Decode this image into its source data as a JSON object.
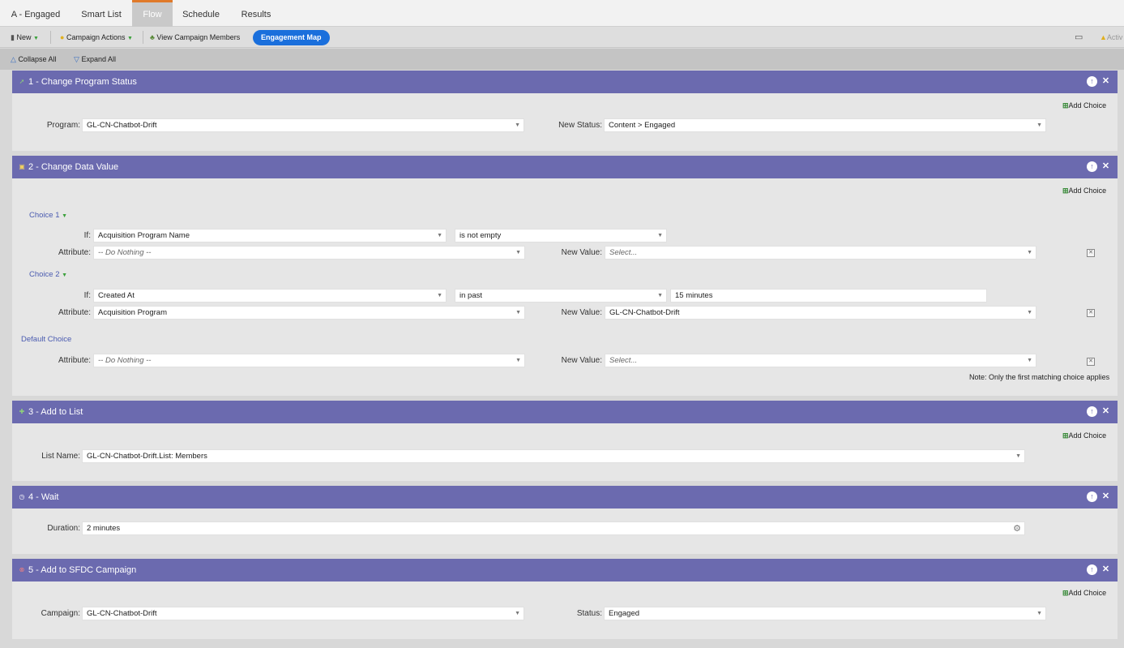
{
  "tabs": [
    "A - Engaged",
    "Smart List",
    "Flow",
    "Schedule",
    "Results"
  ],
  "active_tab": "Flow",
  "toolbar": {
    "new": "New",
    "campaign_actions": "Campaign Actions",
    "view_members": "View Campaign Members",
    "engagement_map": "Engagement Map",
    "active_label": "Activ"
  },
  "subbar": {
    "collapse": "Collapse All",
    "expand": "Expand All"
  },
  "step1": {
    "title": "1 - Change Program Status",
    "add_choice": "Add Choice",
    "program_label": "Program:",
    "program_value": "GL-CN-Chatbot-Drift",
    "status_label": "New Status:",
    "status_value": "Content > Engaged"
  },
  "step2": {
    "title": "2 - Change Data Value",
    "add_choice": "Add Choice",
    "choice1": {
      "label": "Choice 1",
      "if_label": "If:",
      "if_field": "Acquisition Program Name",
      "if_operator": "is not empty",
      "attr_label": "Attribute:",
      "attr_value": "-- Do Nothing --",
      "newval_label": "New Value:",
      "newval_value": "Select..."
    },
    "choice2": {
      "label": "Choice 2",
      "if_label": "If:",
      "if_field": "Created At",
      "if_operator": "in past",
      "if_value": "15 minutes",
      "attr_label": "Attribute:",
      "attr_value": "Acquisition Program",
      "newval_label": "New Value:",
      "newval_value": "GL-CN-Chatbot-Drift"
    },
    "default": {
      "label": "Default Choice",
      "attr_label": "Attribute:",
      "attr_value": "-- Do Nothing --",
      "newval_label": "New Value:",
      "newval_value": "Select..."
    },
    "note": "Note: Only the first matching choice applies"
  },
  "step3": {
    "title": "3 - Add to List",
    "add_choice": "Add Choice",
    "list_label": "List Name:",
    "list_value": "GL-CN-Chatbot-Drift.List: Members"
  },
  "step4": {
    "title": "4 - Wait",
    "duration_label": "Duration:",
    "duration_value": "2 minutes"
  },
  "step5": {
    "title": "5 - Add to SFDC Campaign",
    "add_choice": "Add Choice",
    "campaign_label": "Campaign:",
    "campaign_value": "GL-CN-Chatbot-Drift",
    "status_label": "Status:",
    "status_value": "Engaged"
  }
}
